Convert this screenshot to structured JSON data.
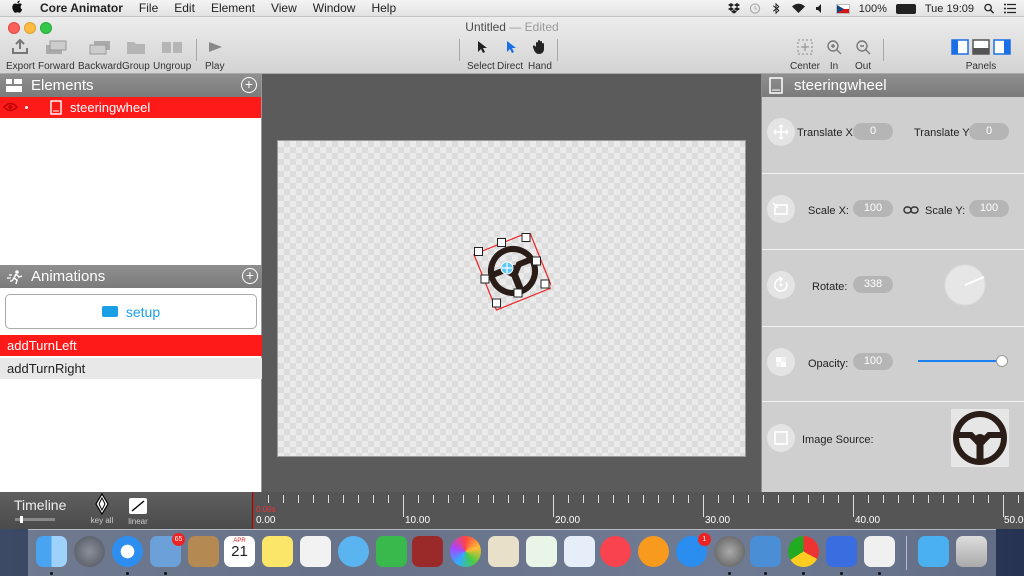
{
  "menubar": {
    "app_name": "Core Animator",
    "menus": [
      "File",
      "Edit",
      "Element",
      "View",
      "Window",
      "Help"
    ],
    "battery": "100%",
    "clock": "Tue 19:09"
  },
  "window": {
    "title": "Untitled",
    "title_suffix": "— Edited"
  },
  "toolbar": {
    "export": "Export",
    "forward": "Forward",
    "backward": "Backward",
    "group": "Group",
    "ungroup": "Ungroup",
    "play": "Play",
    "select": "Select",
    "direct": "Direct",
    "hand": "Hand",
    "center": "Center",
    "zoom_in": "In",
    "zoom_out": "Out",
    "panels": "Panels"
  },
  "elements_panel": {
    "title": "Elements",
    "items": [
      {
        "label": "steeringwheel"
      }
    ]
  },
  "animations_panel": {
    "title": "Animations",
    "setup_label": "setup",
    "items": [
      {
        "label": "addTurnLeft",
        "selected": true
      },
      {
        "label": "addTurnRight",
        "selected": false
      }
    ]
  },
  "inspector": {
    "title": "steeringwheel",
    "translate_x_label": "Translate X:",
    "translate_x": "0",
    "translate_y_label": "Translate Y:",
    "translate_y": "0",
    "scale_x_label": "Scale X:",
    "scale_x": "100",
    "scale_y_label": "Scale Y:",
    "scale_y": "100",
    "rotate_label": "Rotate:",
    "rotate": "338",
    "opacity_label": "Opacity:",
    "opacity": "100",
    "opacity_level": 1.0,
    "image_source_label": "Image Source:"
  },
  "timeline": {
    "title": "Timeline",
    "key_all": "key all",
    "linear": "linear",
    "playhead": "0.00s",
    "labels": [
      "0.00",
      "10.00",
      "20.00",
      "30.00",
      "40.00",
      "50.00"
    ]
  },
  "dock": {
    "calendar_month": "APR",
    "calendar_day": "21",
    "mail_badge": "65",
    "appstore_badge": "1"
  },
  "colors": {
    "selection_red": "#ff1a1a",
    "accent_blue": "#1a9fe6",
    "panel_header": "#868686"
  }
}
